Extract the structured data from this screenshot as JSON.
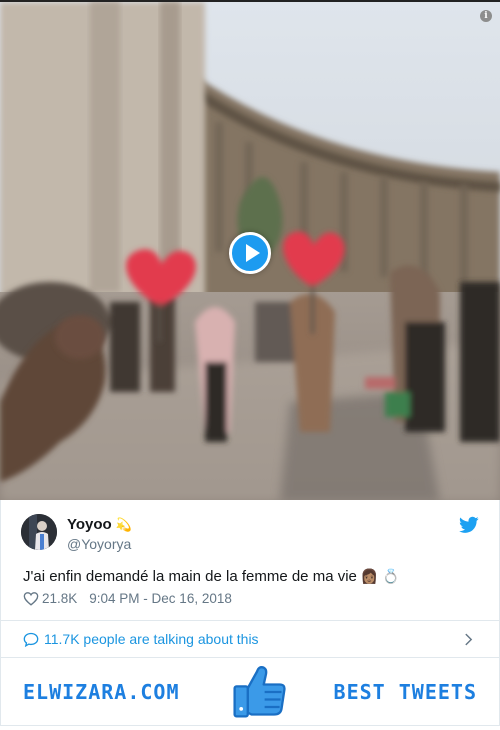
{
  "video": {
    "play_icon": "play-icon",
    "info_icon": "info-icon",
    "info_glyph": "i"
  },
  "tweet": {
    "user_name": "Yoyoo",
    "name_emoji": "💫",
    "handle": "@Yoyorya",
    "text": "J'ai enfin demandé la main de la femme de ma vie",
    "text_emojis": "👩🏽 💍",
    "likes": "21.8K",
    "timestamp": "9:04 PM - Dec 16, 2018",
    "talking": "11.7K people are talking about this"
  },
  "banner": {
    "left": "ELWIZARA.COM",
    "right": "BEST TWEETS"
  },
  "colors": {
    "twitter_blue": "#1da1f2",
    "link_blue": "#1b95e0",
    "banner_blue": "#1d7fe0",
    "muted": "#657786"
  }
}
